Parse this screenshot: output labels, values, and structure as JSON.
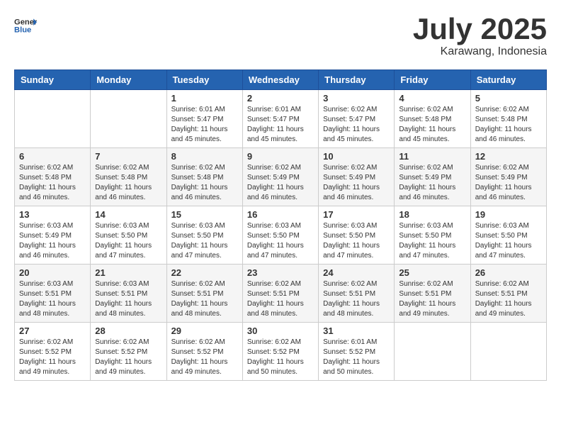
{
  "header": {
    "logo_general": "General",
    "logo_blue": "Blue",
    "month": "July 2025",
    "location": "Karawang, Indonesia"
  },
  "weekdays": [
    "Sunday",
    "Monday",
    "Tuesday",
    "Wednesday",
    "Thursday",
    "Friday",
    "Saturday"
  ],
  "weeks": [
    [
      {
        "day": "",
        "info": ""
      },
      {
        "day": "",
        "info": ""
      },
      {
        "day": "1",
        "info": "Sunrise: 6:01 AM\nSunset: 5:47 PM\nDaylight: 11 hours and 45 minutes."
      },
      {
        "day": "2",
        "info": "Sunrise: 6:01 AM\nSunset: 5:47 PM\nDaylight: 11 hours and 45 minutes."
      },
      {
        "day": "3",
        "info": "Sunrise: 6:02 AM\nSunset: 5:47 PM\nDaylight: 11 hours and 45 minutes."
      },
      {
        "day": "4",
        "info": "Sunrise: 6:02 AM\nSunset: 5:48 PM\nDaylight: 11 hours and 45 minutes."
      },
      {
        "day": "5",
        "info": "Sunrise: 6:02 AM\nSunset: 5:48 PM\nDaylight: 11 hours and 46 minutes."
      }
    ],
    [
      {
        "day": "6",
        "info": "Sunrise: 6:02 AM\nSunset: 5:48 PM\nDaylight: 11 hours and 46 minutes."
      },
      {
        "day": "7",
        "info": "Sunrise: 6:02 AM\nSunset: 5:48 PM\nDaylight: 11 hours and 46 minutes."
      },
      {
        "day": "8",
        "info": "Sunrise: 6:02 AM\nSunset: 5:48 PM\nDaylight: 11 hours and 46 minutes."
      },
      {
        "day": "9",
        "info": "Sunrise: 6:02 AM\nSunset: 5:49 PM\nDaylight: 11 hours and 46 minutes."
      },
      {
        "day": "10",
        "info": "Sunrise: 6:02 AM\nSunset: 5:49 PM\nDaylight: 11 hours and 46 minutes."
      },
      {
        "day": "11",
        "info": "Sunrise: 6:02 AM\nSunset: 5:49 PM\nDaylight: 11 hours and 46 minutes."
      },
      {
        "day": "12",
        "info": "Sunrise: 6:02 AM\nSunset: 5:49 PM\nDaylight: 11 hours and 46 minutes."
      }
    ],
    [
      {
        "day": "13",
        "info": "Sunrise: 6:03 AM\nSunset: 5:49 PM\nDaylight: 11 hours and 46 minutes."
      },
      {
        "day": "14",
        "info": "Sunrise: 6:03 AM\nSunset: 5:50 PM\nDaylight: 11 hours and 47 minutes."
      },
      {
        "day": "15",
        "info": "Sunrise: 6:03 AM\nSunset: 5:50 PM\nDaylight: 11 hours and 47 minutes."
      },
      {
        "day": "16",
        "info": "Sunrise: 6:03 AM\nSunset: 5:50 PM\nDaylight: 11 hours and 47 minutes."
      },
      {
        "day": "17",
        "info": "Sunrise: 6:03 AM\nSunset: 5:50 PM\nDaylight: 11 hours and 47 minutes."
      },
      {
        "day": "18",
        "info": "Sunrise: 6:03 AM\nSunset: 5:50 PM\nDaylight: 11 hours and 47 minutes."
      },
      {
        "day": "19",
        "info": "Sunrise: 6:03 AM\nSunset: 5:50 PM\nDaylight: 11 hours and 47 minutes."
      }
    ],
    [
      {
        "day": "20",
        "info": "Sunrise: 6:03 AM\nSunset: 5:51 PM\nDaylight: 11 hours and 48 minutes."
      },
      {
        "day": "21",
        "info": "Sunrise: 6:03 AM\nSunset: 5:51 PM\nDaylight: 11 hours and 48 minutes."
      },
      {
        "day": "22",
        "info": "Sunrise: 6:02 AM\nSunset: 5:51 PM\nDaylight: 11 hours and 48 minutes."
      },
      {
        "day": "23",
        "info": "Sunrise: 6:02 AM\nSunset: 5:51 PM\nDaylight: 11 hours and 48 minutes."
      },
      {
        "day": "24",
        "info": "Sunrise: 6:02 AM\nSunset: 5:51 PM\nDaylight: 11 hours and 48 minutes."
      },
      {
        "day": "25",
        "info": "Sunrise: 6:02 AM\nSunset: 5:51 PM\nDaylight: 11 hours and 49 minutes."
      },
      {
        "day": "26",
        "info": "Sunrise: 6:02 AM\nSunset: 5:51 PM\nDaylight: 11 hours and 49 minutes."
      }
    ],
    [
      {
        "day": "27",
        "info": "Sunrise: 6:02 AM\nSunset: 5:52 PM\nDaylight: 11 hours and 49 minutes."
      },
      {
        "day": "28",
        "info": "Sunrise: 6:02 AM\nSunset: 5:52 PM\nDaylight: 11 hours and 49 minutes."
      },
      {
        "day": "29",
        "info": "Sunrise: 6:02 AM\nSunset: 5:52 PM\nDaylight: 11 hours and 49 minutes."
      },
      {
        "day": "30",
        "info": "Sunrise: 6:02 AM\nSunset: 5:52 PM\nDaylight: 11 hours and 50 minutes."
      },
      {
        "day": "31",
        "info": "Sunrise: 6:01 AM\nSunset: 5:52 PM\nDaylight: 11 hours and 50 minutes."
      },
      {
        "day": "",
        "info": ""
      },
      {
        "day": "",
        "info": ""
      }
    ]
  ]
}
